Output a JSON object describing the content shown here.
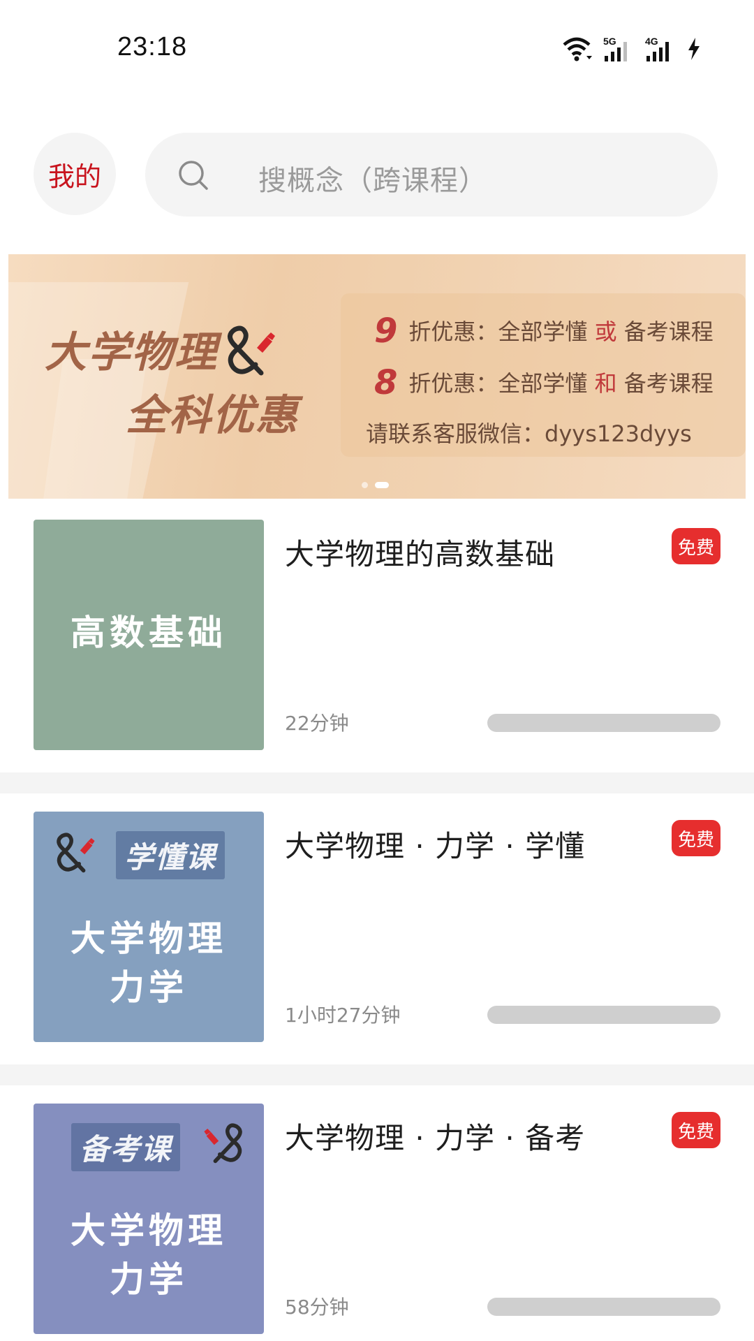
{
  "status_bar": {
    "time": "23:18",
    "icons": [
      "wifi-icon",
      "signal-5g-icon",
      "signal-4g-icon",
      "charging-icon"
    ]
  },
  "header": {
    "my_label": "我的",
    "search_placeholder": "搜概念（跨课程）",
    "search_icon": "search-icon"
  },
  "banner": {
    "title_line1": "大学物理",
    "title_line2": "全科优惠",
    "logo_icon": "ampersand-logo-icon",
    "promo1": {
      "number": "9",
      "prefix": "折优惠：全部学懂 ",
      "highlight": "或",
      "suffix": " 备考课程"
    },
    "promo2": {
      "number": "8",
      "prefix": "折优惠：全部学懂 ",
      "highlight": "和",
      "suffix": " 备考课程"
    },
    "contact": "请联系客服微信：dyys123dyys",
    "slides_count": 2,
    "active_slide": 2
  },
  "courses": [
    {
      "title": "大学物理的高数基础",
      "badge": "免费",
      "duration": "22分钟",
      "progress": 0,
      "thumb_color": "#8fab99",
      "thumb_line1": "高数基础",
      "thumb_line2": "",
      "thumb_tag": ""
    },
    {
      "title": "大学物理 · 力学 · 学懂",
      "badge": "免费",
      "duration": "1小时27分钟",
      "progress": 0,
      "thumb_color": "#85a0bf",
      "thumb_line1": "大学物理",
      "thumb_line2": "力学",
      "thumb_tag": "学懂课"
    },
    {
      "title": "大学物理 · 力学 · 备考",
      "badge": "免费",
      "duration": "58分钟",
      "progress": 0,
      "thumb_color": "#858fbf",
      "thumb_line1": "大学物理",
      "thumb_line2": "力学",
      "thumb_tag": "备考课"
    }
  ],
  "colors": {
    "accent_red": "#e62e2e",
    "my_label_red": "#c8141e",
    "banner_brown": "#a26447"
  }
}
